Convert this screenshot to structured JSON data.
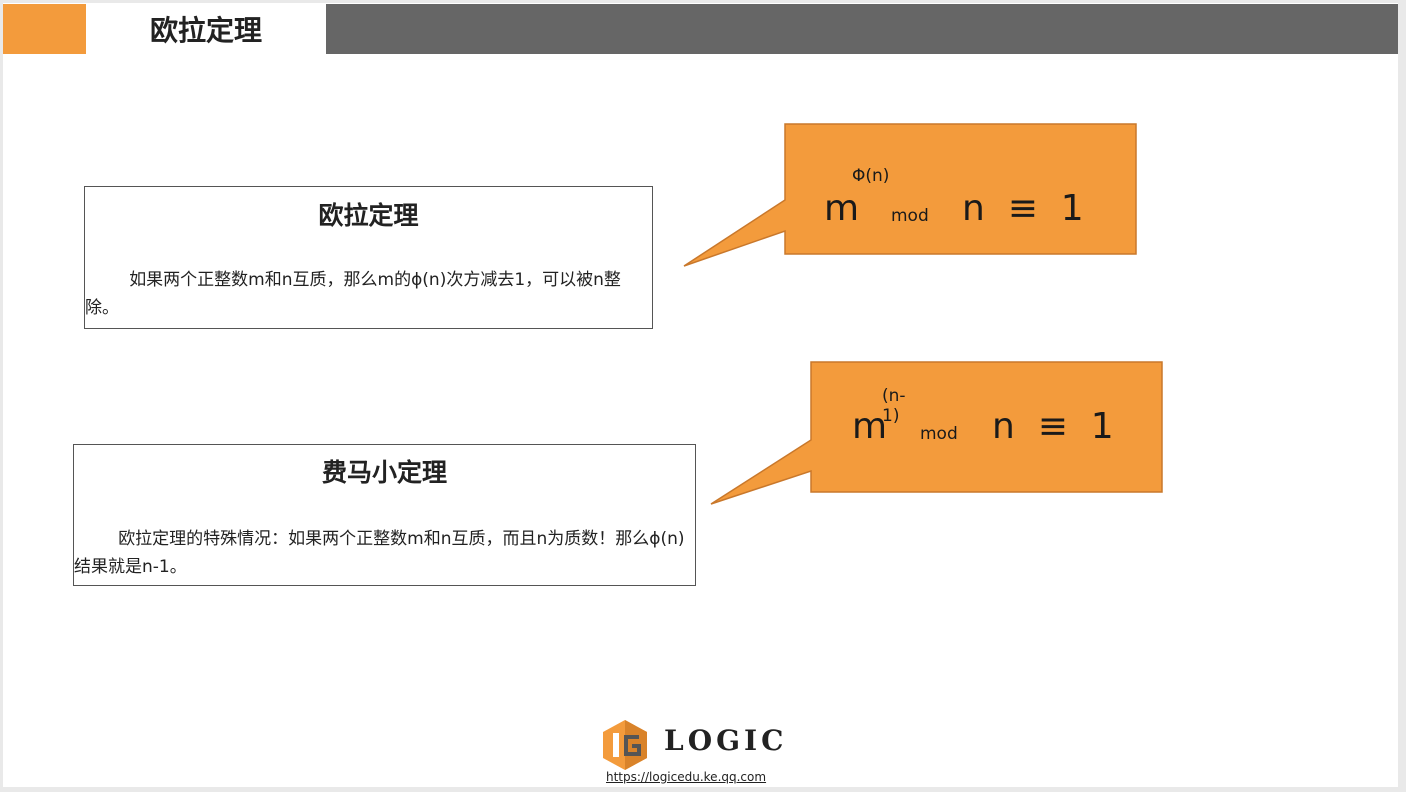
{
  "header": {
    "title": "欧拉定理"
  },
  "boxes": [
    {
      "title": "欧拉定理",
      "body": "如果两个正整数m和n互质，那么m的ϕ(n)次方减去1，可以被n整除。"
    },
    {
      "title": "费马小定理",
      "body": "欧拉定理的特殊情况：如果两个正整数m和n互质，而且n为质数！那么ϕ(n)结果就是n-1。"
    }
  ],
  "formulas": [
    {
      "base": "m",
      "exponent": "Φ(n)",
      "mod": "mod",
      "rest": "n  ≡  1"
    },
    {
      "base": "m",
      "exponent": "(n-1)",
      "mod": "mod",
      "rest": "n  ≡  1"
    }
  ],
  "footer": {
    "logo_text": "LOGIC",
    "url": "https://logicedu.ke.qq.com"
  },
  "colors": {
    "accent": "#f39b3c",
    "header_bar": "#666666"
  }
}
